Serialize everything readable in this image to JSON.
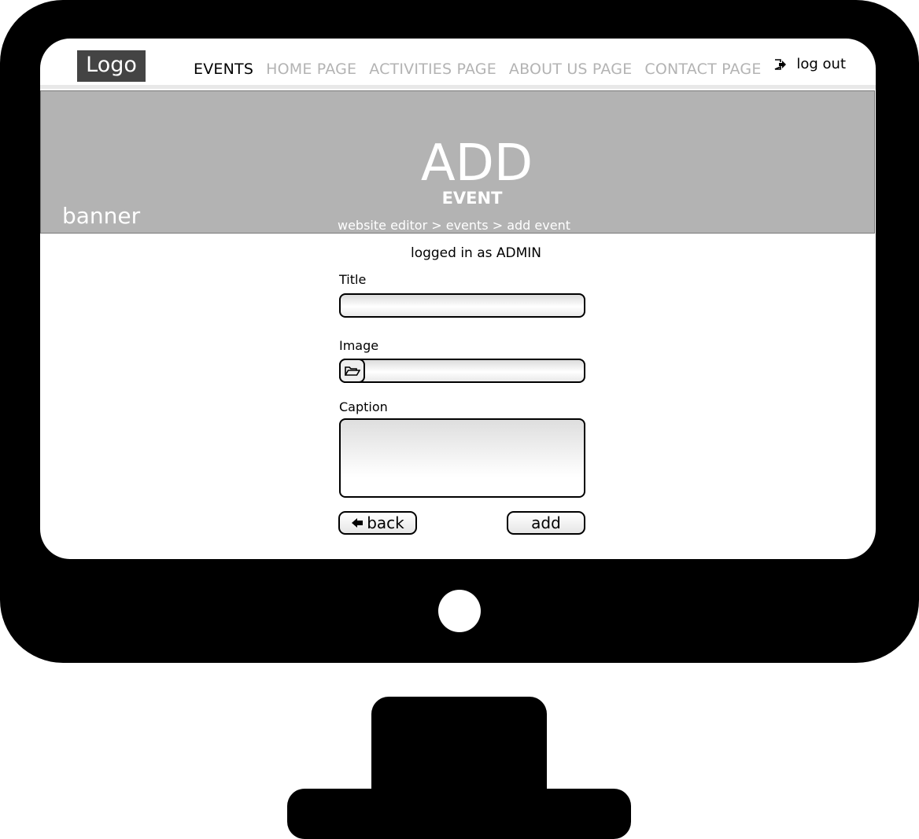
{
  "header": {
    "logo": "Logo",
    "nav": [
      {
        "label": "EVENTS",
        "active": true
      },
      {
        "label": "HOME PAGE",
        "active": false
      },
      {
        "label": "ACTIVITIES PAGE",
        "active": false
      },
      {
        "label": "ABOUT US PAGE",
        "active": false
      },
      {
        "label": "CONTACT PAGE",
        "active": false
      }
    ],
    "logout_label": "log out",
    "logout_icon": "logout-icon"
  },
  "banner": {
    "label": "banner",
    "title": "ADD",
    "subtitle": "EVENT",
    "breadcrumb": "website editor > events > add event"
  },
  "status": {
    "logged_in": "logged in as ADMIN"
  },
  "form": {
    "title_label": "Title",
    "title_value": "",
    "image_label": "Image",
    "image_value": "",
    "image_icon": "folder-open-icon",
    "caption_label": "Caption",
    "caption_value": "",
    "back_label": "back",
    "back_icon": "arrow-left-icon",
    "add_label": "add"
  },
  "colors": {
    "banner_bg": "#b3b3b3",
    "logo_bg": "#444444",
    "nav_inactive": "#b3b3b3",
    "frame": "#000000"
  }
}
